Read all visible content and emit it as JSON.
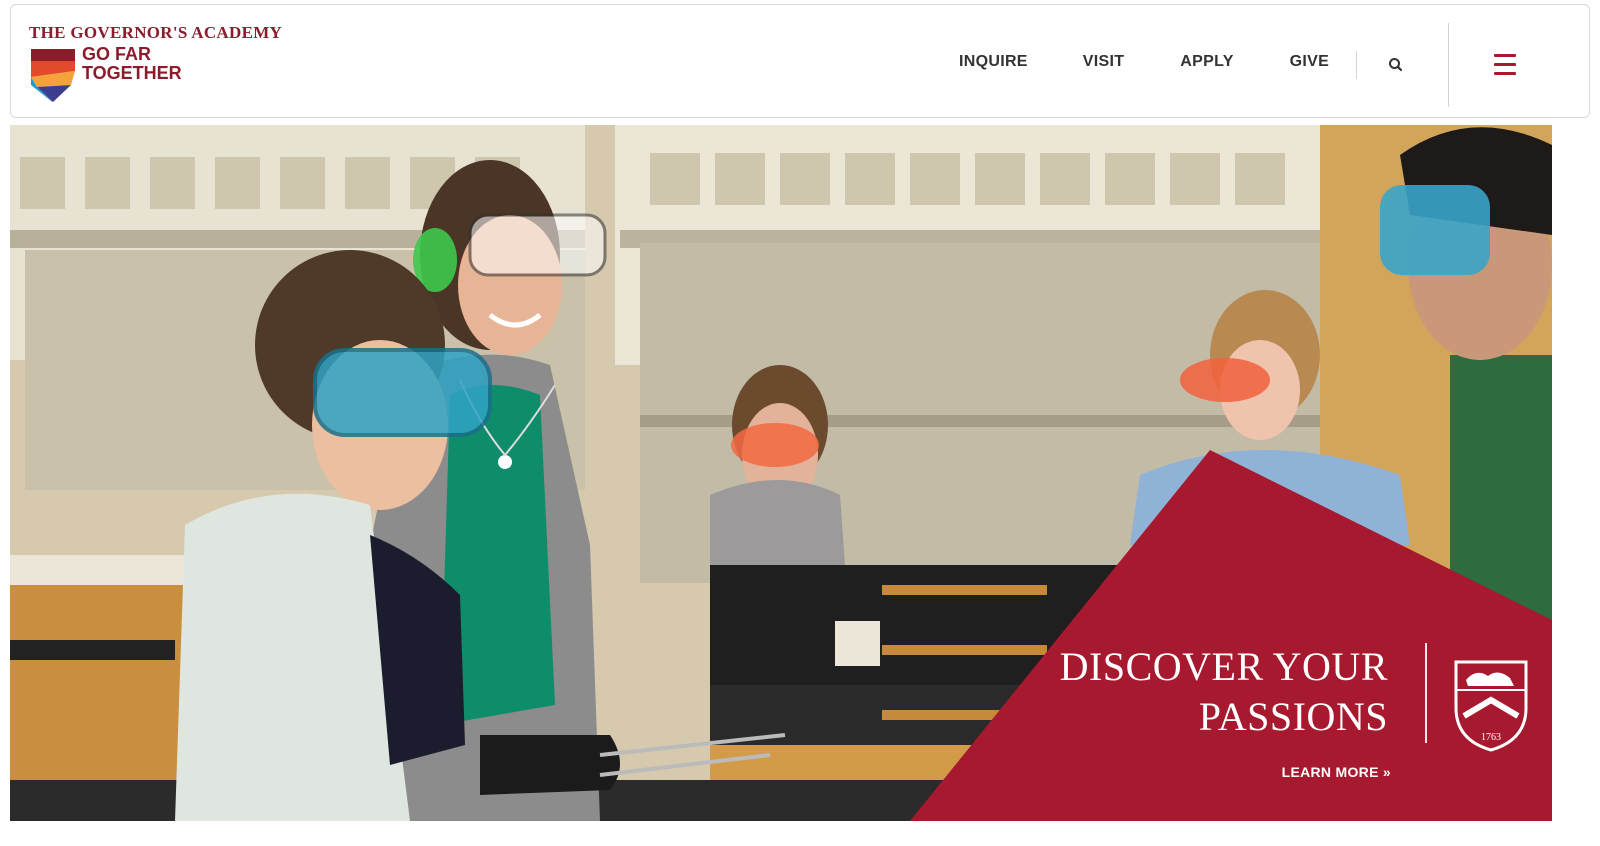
{
  "brand": {
    "school_name": "THE GOVERNOR'S ACADEMY",
    "tagline_line1": "GO FAR",
    "tagline_line2": "TOGETHER",
    "color_primary": "#8b1c2c",
    "color_accent": "#a6192e"
  },
  "nav": {
    "items": [
      {
        "label": "INQUIRE"
      },
      {
        "label": "VISIT"
      },
      {
        "label": "APPLY"
      },
      {
        "label": "GIVE"
      }
    ],
    "search_icon": "search-icon",
    "menu_icon": "hamburger-menu-icon"
  },
  "hero": {
    "image_alt": "Students wearing safety goggles in a science lab with a smiling teacher",
    "headline_line1": "DISCOVER YOUR",
    "headline_line2": "PASSIONS",
    "cta_label": "LEARN MORE »",
    "crest_year": "1763",
    "panel_color": "#a6192e"
  }
}
